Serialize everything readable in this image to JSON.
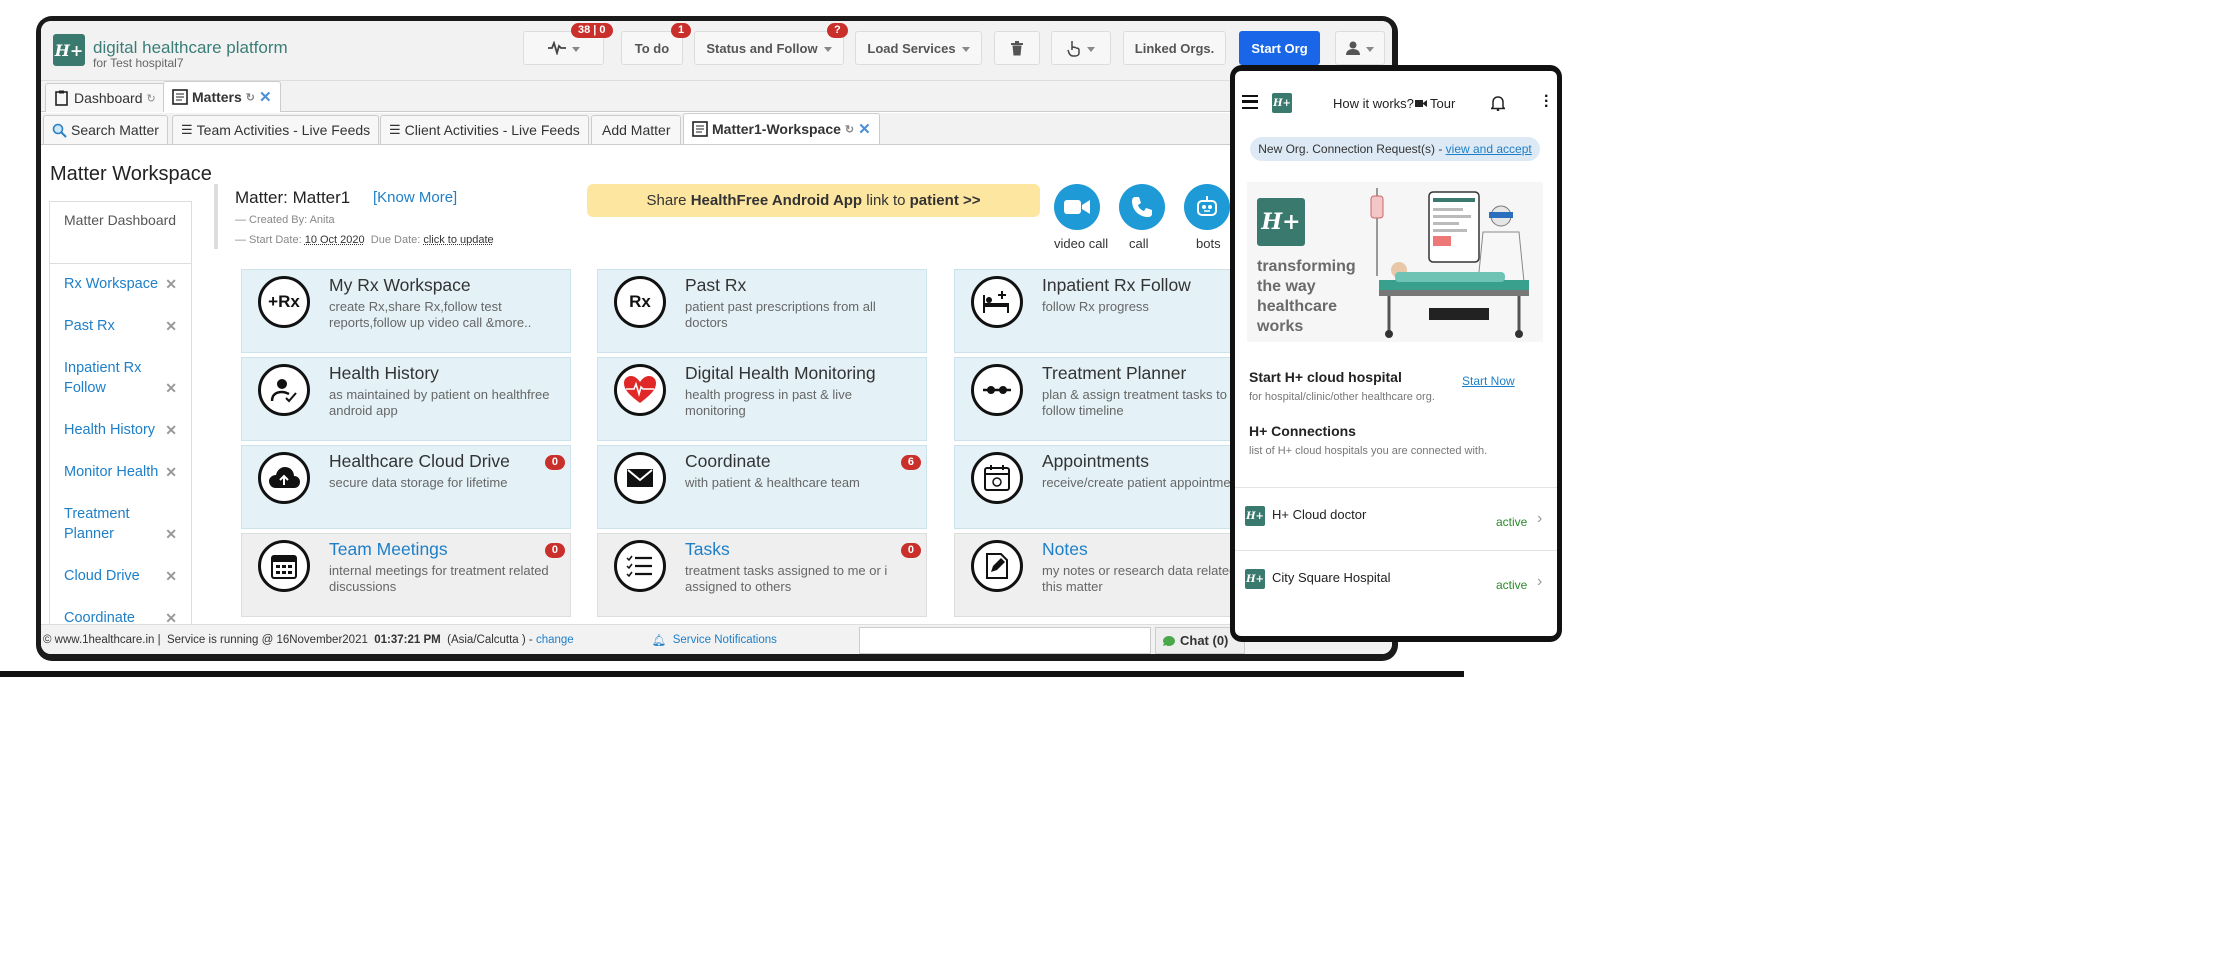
{
  "brand": {
    "title": "digital healthcare platform",
    "subtitle": "for Test hospital7",
    "logo": "H+"
  },
  "topbar": {
    "activity_badge": "38 | 0",
    "todo_label": "To do",
    "todo_badge": "1",
    "status_label": "Status and Follow",
    "status_badge": "?",
    "load_label": "Load Services",
    "linked_label": "Linked Orgs.",
    "startorg_label": "Start Org"
  },
  "tabs1": [
    {
      "label": "Dashboard"
    },
    {
      "label": "Matters"
    }
  ],
  "tabs2": [
    {
      "label": "Search Matter"
    },
    {
      "label": "Team Activities - Live Feeds"
    },
    {
      "label": "Client Activities - Live Feeds"
    },
    {
      "label": "Add Matter"
    },
    {
      "label": "Matter1-Workspace"
    }
  ],
  "sidebar": {
    "title": "Matter Workspace",
    "first": "Matter Dashboard",
    "items": [
      {
        "label": "Rx Workspace"
      },
      {
        "label": "Past Rx"
      },
      {
        "label": "Inpatient Rx Follow"
      },
      {
        "label": "Health History"
      },
      {
        "label": "Monitor Health"
      },
      {
        "label": "Treatment Planner"
      },
      {
        "label": "Cloud Drive"
      },
      {
        "label": "Coordinate"
      }
    ]
  },
  "matter": {
    "title": "Matter: Matter1",
    "know_more": "[Know More]",
    "created": "— Created By: Anita",
    "start_prefix": "— Start Date:",
    "start_date": "10 Oct 2020",
    "due_prefix": "Due Date:",
    "due_value": "click to update"
  },
  "share": {
    "pre": "Share ",
    "bold1": "HealthFree Android App",
    "mid": " link to ",
    "bold2": "patient >>"
  },
  "actions": [
    {
      "label": "video call"
    },
    {
      "label": "call"
    },
    {
      "label": "bots"
    }
  ],
  "cards": [
    {
      "title": "My Rx Workspace",
      "desc": "create Rx,share Rx,follow test reports,follow up video call &more..",
      "icon": "+Rx"
    },
    {
      "title": "Past Rx",
      "desc": "patient past prescriptions from all doctors",
      "icon": "Rx"
    },
    {
      "title": "Inpatient Rx Follow",
      "desc": "follow Rx progress"
    },
    {
      "title": "Health History",
      "desc": "as maintained by patient on healthfree android app"
    },
    {
      "title": "Digital Health Monitoring",
      "desc": "health progress in past & live monitoring"
    },
    {
      "title": "Treatment Planner",
      "desc": "plan & assign treatment tasks to team & follow timeline"
    },
    {
      "title": "Healthcare Cloud Drive",
      "desc": "secure data storage for lifetime",
      "badge": "0"
    },
    {
      "title": "Coordinate",
      "desc": "with patient & healthcare team",
      "badge": "6"
    },
    {
      "title": "Appointments",
      "desc": "receive/create patient appointments"
    },
    {
      "title": "Team Meetings",
      "desc": "internal meetings for treatment related discussions",
      "badge": "0"
    },
    {
      "title": "Tasks",
      "desc": "treatment tasks assigned to me or i assigned to others",
      "badge": "0"
    },
    {
      "title": "Notes",
      "desc": "my notes or research data related to this matter"
    }
  ],
  "footer": {
    "site": "© www.1healthcare.in |",
    "running": "Service is running @ 16November2021",
    "time": "01:37:21 PM",
    "tz": "(Asia/Calcutta ) -",
    "change": "change",
    "notifications": "Service Notifications",
    "chat": "Chat (0)"
  },
  "phone": {
    "how": "How it works?",
    "tour": "Tour",
    "notice_pre": "New Org. Connection Request(s) - ",
    "notice_link": "view and accept",
    "promo_text": "transforming the way healthcare works",
    "cloud_title": "Start H+ cloud hospital",
    "cloud_desc": "for hospital/clinic/other healthcare org.",
    "start_now": "Start Now",
    "conn_title": "H+ Connections",
    "conn_desc": "list of H+ cloud hospitals you are connected with.",
    "connections": [
      {
        "name": "H+ Cloud doctor",
        "status": "active"
      },
      {
        "name": "City Square Hospital",
        "status": "active"
      }
    ]
  },
  "colors": {
    "brand": "#3a7a6e",
    "accent": "#1a66e8",
    "link": "#1e7fc8",
    "badge": "#c9302c",
    "share_bg": "#fde6a0",
    "card_bg": "#e4f2f7"
  }
}
